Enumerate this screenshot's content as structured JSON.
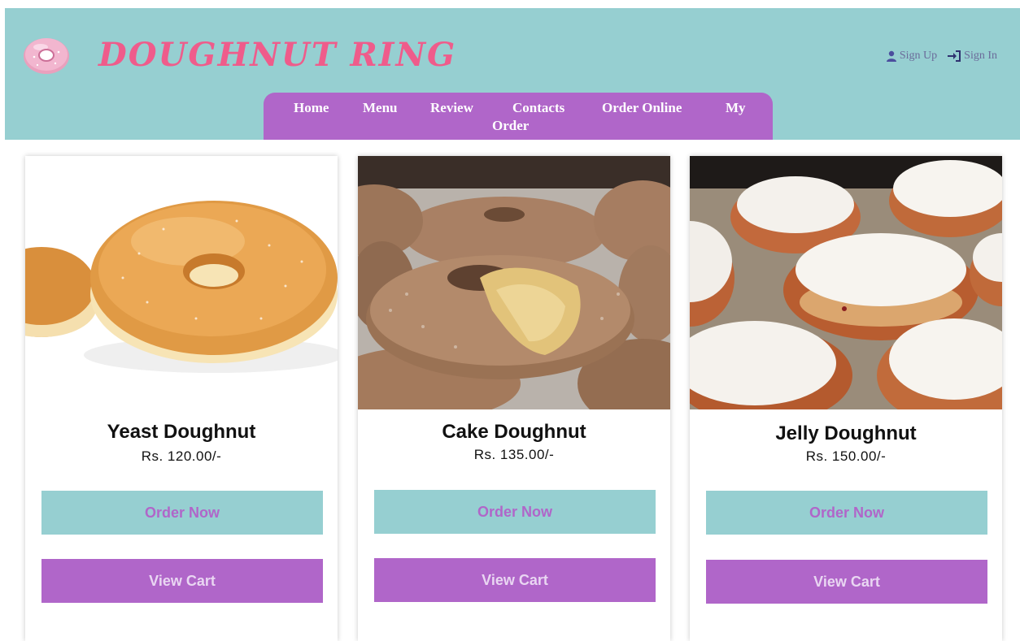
{
  "brand": {
    "name": "DOUGHNUT RING",
    "color": "#ef5c8b"
  },
  "auth": {
    "sign_up": "Sign Up",
    "sign_in": "Sign In"
  },
  "nav": {
    "items": [
      "Home",
      "Menu",
      "Review",
      "Contacts",
      "Order Online",
      "My",
      "Order"
    ]
  },
  "colors": {
    "header_bg": "#96cfd1",
    "nav_bg": "#b066c9",
    "order_button_bg": "#96cfd1",
    "cart_button_bg": "#b066c9"
  },
  "products": [
    {
      "name": "Yeast Doughnut",
      "price": "Rs. 120.00/-",
      "order_label": "Order Now",
      "cart_label": "View Cart",
      "image": "yeast-doughnut-photo"
    },
    {
      "name": "Cake Doughnut",
      "price": "Rs. 135.00/-",
      "order_label": "Order Now",
      "cart_label": "View Cart",
      "image": "cake-doughnut-photo"
    },
    {
      "name": "Jelly Doughnut",
      "price": "Rs. 150.00/-",
      "order_label": "Order Now",
      "cart_label": "View Cart",
      "image": "jelly-doughnut-photo"
    }
  ]
}
